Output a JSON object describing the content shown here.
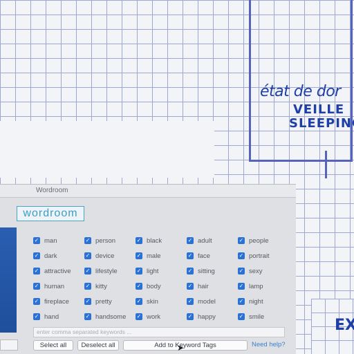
{
  "background": {
    "handwriting": [
      "état de dor",
      "VEILLE",
      "SLEEPING",
      "EX"
    ]
  },
  "window": {
    "title": "Wordroom",
    "logo": "wordroom",
    "keywords": [
      "man",
      "person",
      "black",
      "adult",
      "people",
      "dark",
      "device",
      "male",
      "face",
      "portrait",
      "attractive",
      "lifestyle",
      "light",
      "sitting",
      "sexy",
      "human",
      "kitty",
      "body",
      "hair",
      "lamp",
      "fireplace",
      "pretty",
      "skin",
      "model",
      "night",
      "hand",
      "handsome",
      "work",
      "happy",
      "smile"
    ],
    "check_glyph": "✓",
    "input_placeholder": "enter comma separated keywords ...",
    "buttons": {
      "select_all": "Select all",
      "deselect_all": "Deselect all",
      "add_tags": "Add to Keyword Tags"
    },
    "help_link": "Need help?"
  },
  "colors": {
    "accent": "#2a72d6",
    "logo": "#3b9ec7",
    "ink": "#1f3fa6"
  }
}
